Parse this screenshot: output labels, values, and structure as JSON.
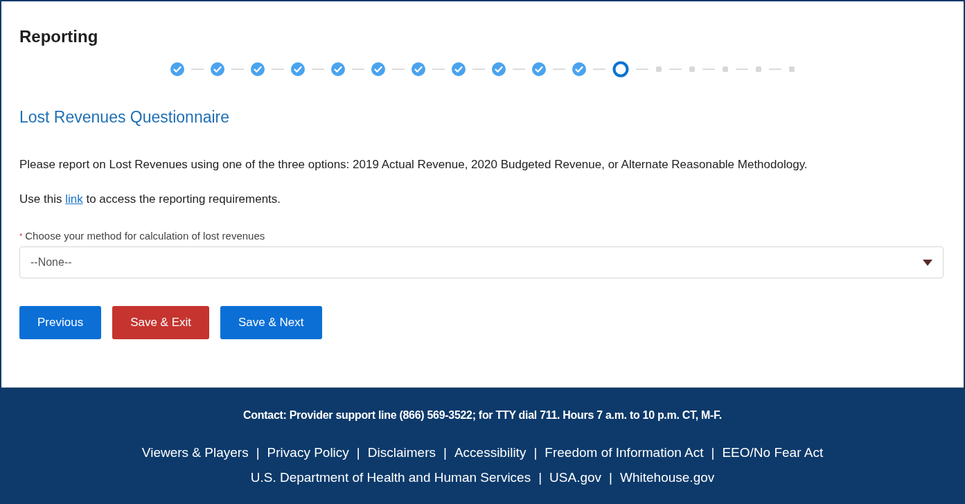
{
  "page": {
    "title": "Reporting"
  },
  "stepper": {
    "steps": [
      {
        "kind": "complete"
      },
      {
        "kind": "complete"
      },
      {
        "kind": "complete"
      },
      {
        "kind": "complete"
      },
      {
        "kind": "complete"
      },
      {
        "kind": "complete"
      },
      {
        "kind": "complete"
      },
      {
        "kind": "complete"
      },
      {
        "kind": "complete"
      },
      {
        "kind": "complete"
      },
      {
        "kind": "complete"
      },
      {
        "kind": "current"
      },
      {
        "kind": "upcoming"
      },
      {
        "kind": "upcoming"
      },
      {
        "kind": "upcoming"
      },
      {
        "kind": "upcoming"
      },
      {
        "kind": "upcoming"
      }
    ]
  },
  "section": {
    "title": "Lost Revenues Questionnaire",
    "intro": "Please report on Lost Revenues using one of the three options: 2019 Actual Revenue, 2020 Budgeted Revenue, or Alternate Reasonable Methodology.",
    "link_sentence": {
      "before": "Use this",
      "link": "link",
      "after": "to access the reporting requirements."
    },
    "field": {
      "required_mark": "*",
      "label": "Choose your method for calculation of lost revenues",
      "value": "--None--"
    }
  },
  "buttons": [
    {
      "label": "Previous",
      "kind": "primary"
    },
    {
      "label": "Save & Exit",
      "kind": "danger"
    },
    {
      "label": "Save & Next",
      "kind": "primary"
    }
  ],
  "footer": {
    "contact": "Contact: Provider support line (866) 569-3522; for TTY dial 711. Hours 7 a.m. to 10 p.m. CT, M-F.",
    "link_rows": [
      [
        {
          "label": "Viewers & Players",
          "separator": "|"
        },
        {
          "label": "Privacy Policy",
          "separator": "|"
        },
        {
          "label": "Disclaimers",
          "separator": "|"
        },
        {
          "label": "Accessibility",
          "separator": "|"
        },
        {
          "label": "Freedom of Information Act",
          "separator": "|"
        },
        {
          "label": "EEO/No Fear Act"
        }
      ],
      [
        {
          "label": "U.S. Department of Health and Human Services",
          "separator": "|"
        },
        {
          "label": "USA.gov",
          "separator": "|"
        },
        {
          "label": "Whitehouse.gov"
        }
      ]
    ]
  }
}
